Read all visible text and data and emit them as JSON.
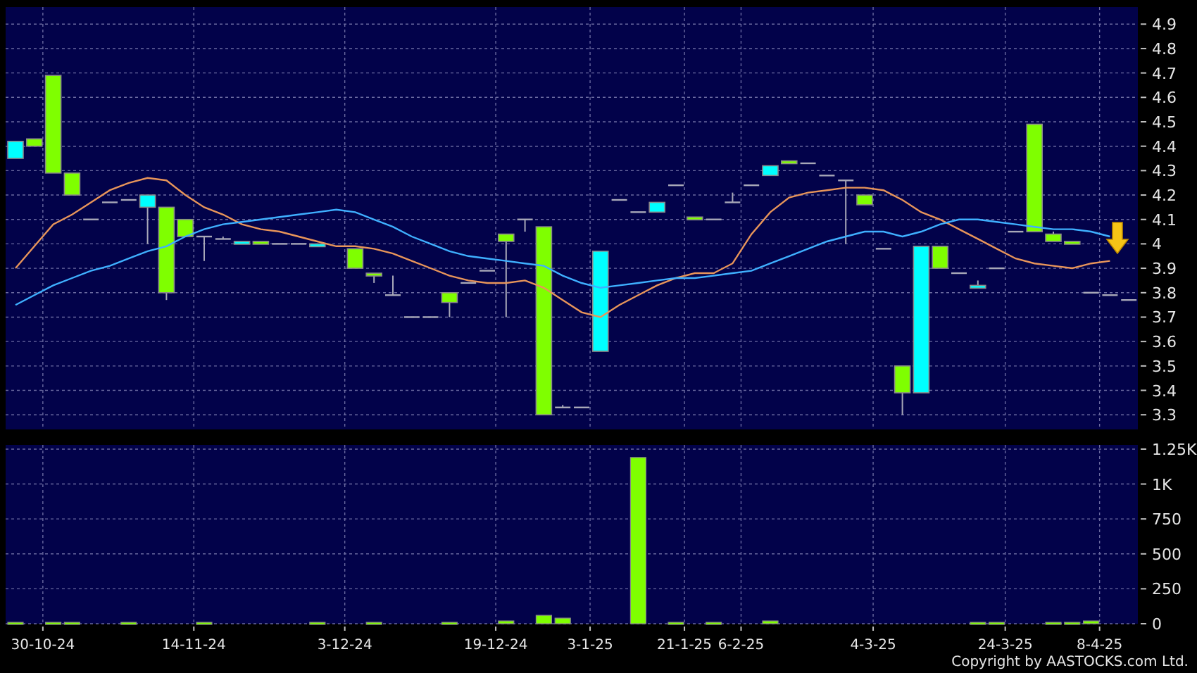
{
  "price_chart": {
    "chart_data": {
      "type": "line",
      "grid": true,
      "ylim": [
        3.24,
        4.97
      ],
      "yticks": [
        4.9,
        4.8,
        4.7,
        4.6,
        4.5,
        4.4,
        4.3,
        4.2,
        4.1,
        4,
        3.9,
        3.8,
        3.7,
        3.6,
        3.5,
        3.4,
        3.3
      ],
      "series": [
        {
          "color": "#e8955a",
          "values": [
            3.9,
            3.99,
            4.08,
            4.12,
            4.17,
            4.22,
            4.25,
            4.27,
            4.26,
            4.2,
            4.15,
            4.12,
            4.08,
            4.06,
            4.05,
            4.03,
            4.01,
            3.99,
            3.99,
            3.98,
            3.96,
            3.93,
            3.9,
            3.87,
            3.85,
            3.84,
            3.84,
            3.85,
            3.82,
            3.77,
            3.72,
            3.7,
            3.75,
            3.79,
            3.83,
            3.86,
            3.88,
            3.88,
            3.92,
            4.04,
            4.13,
            4.19,
            4.21,
            4.22,
            4.23,
            4.23,
            4.22,
            4.18,
            4.13,
            4.1,
            4.06,
            4.02,
            3.98,
            3.94,
            3.92,
            3.91,
            3.9,
            3.92,
            3.93,
            null
          ]
        },
        {
          "color": "#3fb0ff",
          "values": [
            3.75,
            3.79,
            3.83,
            3.86,
            3.89,
            3.91,
            3.94,
            3.97,
            3.99,
            4.03,
            4.06,
            4.08,
            4.09,
            4.1,
            4.11,
            4.12,
            4.13,
            4.14,
            4.13,
            4.1,
            4.07,
            4.03,
            4,
            3.97,
            3.95,
            3.94,
            3.93,
            3.92,
            3.91,
            3.87,
            3.84,
            3.82,
            3.83,
            3.84,
            3.85,
            3.86,
            3.86,
            3.87,
            3.88,
            3.89,
            3.92,
            3.95,
            3.98,
            4.01,
            4.03,
            4.05,
            4.05,
            4.03,
            4.05,
            4.08,
            4.1,
            4.1,
            4.09,
            4.08,
            4.07,
            4.06,
            4.06,
            4.05,
            4.03,
            null
          ]
        }
      ]
    }
  },
  "volume_chart": {
    "chart_data": {
      "type": "bar",
      "grid": true,
      "ylim": [
        0,
        1280
      ],
      "categories": [
        null,
        "30-10-24",
        null,
        null,
        null,
        null,
        null,
        null,
        null,
        "14-11-24",
        null,
        null,
        null,
        null,
        null,
        null,
        null,
        "3-12-24",
        null,
        null,
        null,
        null,
        null,
        null,
        null,
        "19-12-24",
        null,
        null,
        null,
        null,
        "3-1-25",
        null,
        null,
        null,
        null,
        "21-1-25",
        null,
        null,
        "6-2-25",
        null,
        null,
        null,
        null,
        null,
        null,
        "4-3-25",
        null,
        null,
        null,
        null,
        null,
        null,
        "24-3-25",
        null,
        null,
        null,
        null,
        "8-4-25",
        null,
        null
      ],
      "yticks": [
        {
          "value": 1250,
          "label": "1.25K"
        },
        {
          "value": 1000,
          "label": "1K"
        },
        750,
        500,
        250,
        0
      ],
      "series": [
        {
          "color": "#7fff00",
          "values": [
            10,
            null,
            10,
            10,
            null,
            null,
            10,
            null,
            null,
            null,
            10,
            null,
            null,
            null,
            null,
            null,
            10,
            null,
            null,
            10,
            null,
            null,
            null,
            10,
            null,
            null,
            20,
            null,
            60,
            40,
            null,
            null,
            null,
            1190,
            null,
            10,
            null,
            10,
            null,
            null,
            20,
            null,
            null,
            null,
            null,
            null,
            null,
            null,
            null,
            null,
            null,
            10,
            10,
            null,
            null,
            10,
            10,
            20,
            null,
            null
          ]
        }
      ]
    }
  },
  "copyright": "Copyright by AASTOCKS.com Ltd."
}
